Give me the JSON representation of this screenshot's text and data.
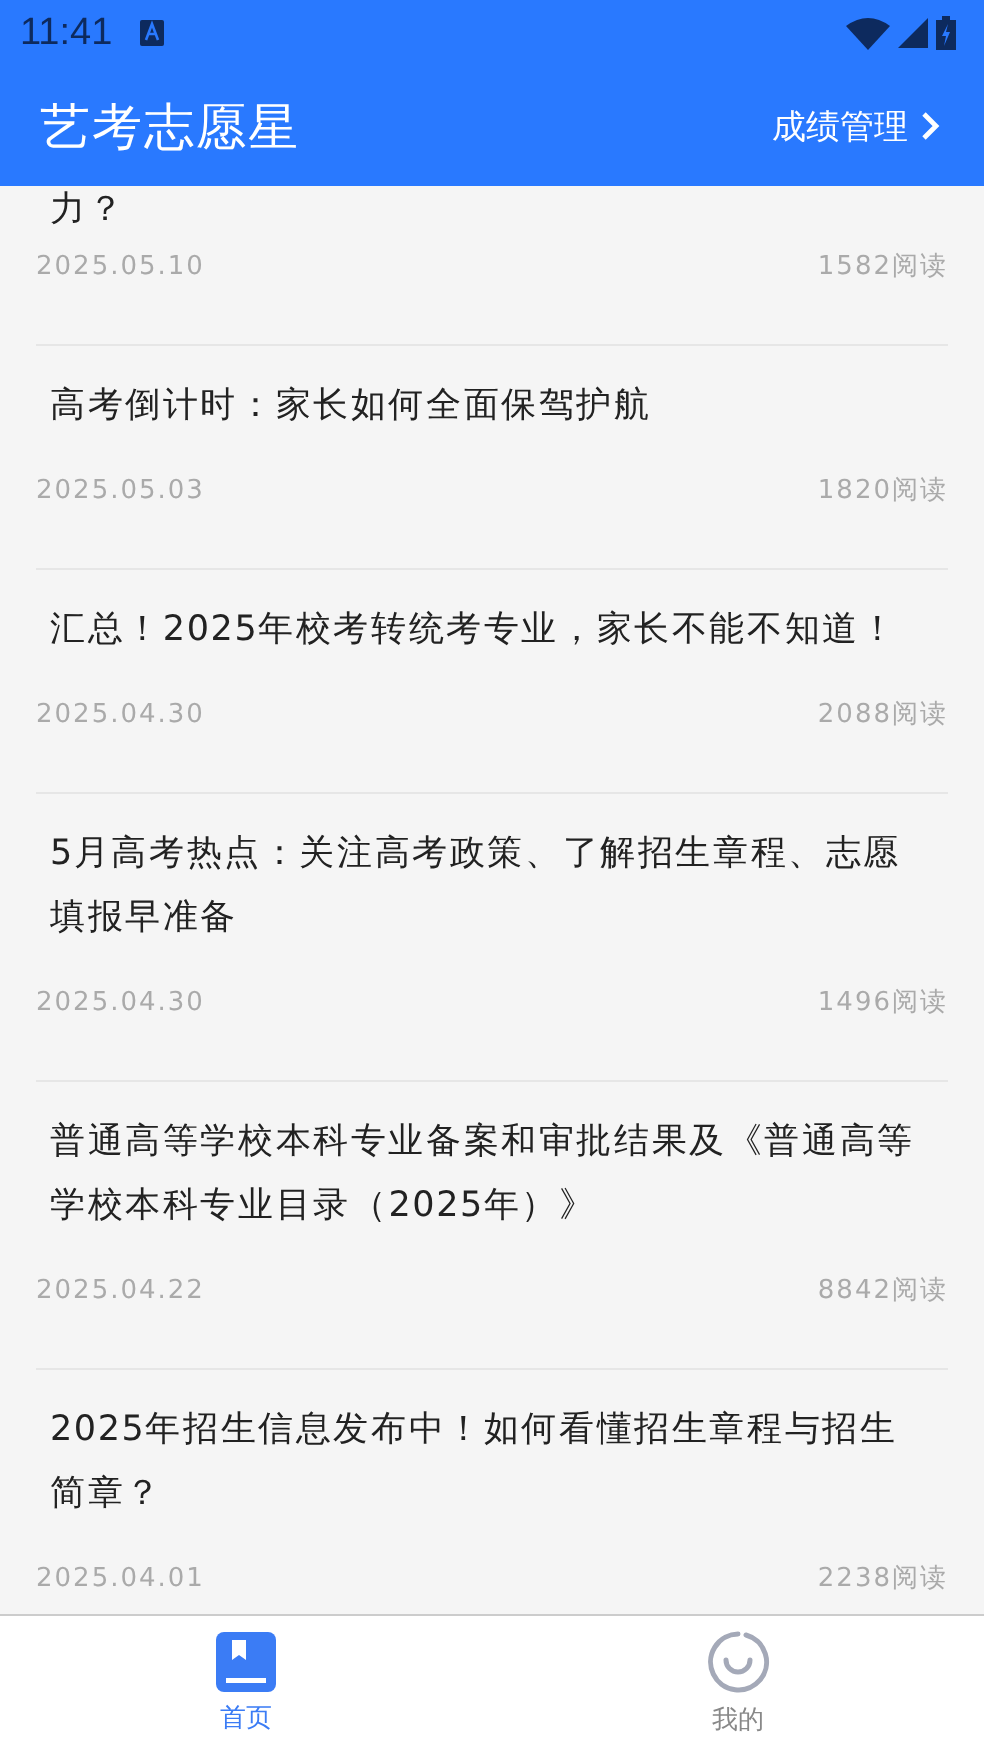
{
  "status_bar": {
    "time": "11:41"
  },
  "app_bar": {
    "title": "艺考志愿星",
    "action": "成绩管理"
  },
  "articles": [
    {
      "title": "力？",
      "date": "2025.05.10",
      "reads": "1582阅读"
    },
    {
      "title": "高考倒计时：家长如何全面保驾护航",
      "date": "2025.05.03",
      "reads": "1820阅读"
    },
    {
      "title": "汇总！2025年校考转统考专业，家长不能不知道！",
      "date": "2025.04.30",
      "reads": "2088阅读"
    },
    {
      "title": "5月高考热点：关注高考政策、了解招生章程、志愿填报早准备",
      "date": "2025.04.30",
      "reads": "1496阅读"
    },
    {
      "title": "普通高等学校本科专业备案和审批结果及《普通高等学校本科专业目录（2025年）》",
      "date": "2025.04.22",
      "reads": "8842阅读"
    },
    {
      "title": "2025年招生信息发布中！如何看懂招生章程与招生简章？",
      "date": "2025.04.01",
      "reads": "2238阅读"
    }
  ],
  "tabs": [
    {
      "label": "首页",
      "kind": "home",
      "selected": true
    },
    {
      "label": "我的",
      "kind": "profile",
      "selected": false
    }
  ]
}
